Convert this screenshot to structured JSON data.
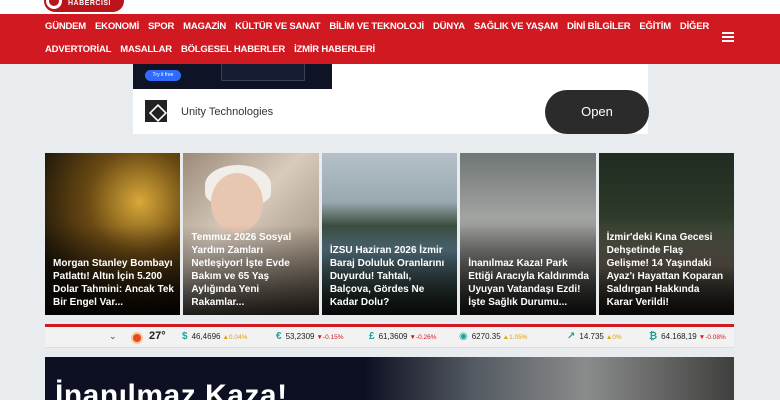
{
  "logo": {
    "text": "HABERCİSİ"
  },
  "nav": {
    "row1": [
      "GÜNDEM",
      "EKONOMİ",
      "SPOR",
      "MAGAZİN",
      "KÜLTÜR VE SANAT",
      "BİLİM VE TEKNOLOJİ",
      "DÜNYA",
      "SAĞLIK VE YAŞAM",
      "DİNİ BİLGİLER",
      "EĞİTİM",
      "DİĞER"
    ],
    "row2": [
      "ADVERTORİAL",
      "MASALLAR",
      "BÖLGESEL HABERLER",
      "İZMİR HABERLERİ"
    ]
  },
  "ad": {
    "try_label": "Try it free",
    "advertiser": "Unity Technologies",
    "cta": "Open"
  },
  "cards": [
    {
      "title": "Morgan Stanley Bombayı Patlattı! Altın İçin 5.200 Dolar Tahmini: Ancak Tek Bir Engel Var..."
    },
    {
      "title": "Temmuz 2026 Sosyal Yardım Zamları Netleşiyor! İşte Evde Bakım ve 65 Yaş Aylığında Yeni Rakamlar..."
    },
    {
      "title": "İZSU Haziran 2026 İzmir Baraj Doluluk Oranlarını Duyurdu! Tahtalı, Balçova, Gördes Ne Kadar Dolu?"
    },
    {
      "title": "İnanılmaz Kaza! Park Ettiği Aracıyla Kaldırımda Uyuyan Vatandaşı Ezdi! İşte Sağlık Durumu..."
    },
    {
      "title": "İzmir'deki Kına Gecesi Dehşetinde Flaş Gelişme! 14 Yaşındaki Ayaz'ı Hayattan Koparan Saldırgan Hakkında Karar Verildi!"
    }
  ],
  "ticker": {
    "chevron": "⌄",
    "temperature": "27°",
    "items": [
      {
        "symbol": "$",
        "value": "46,4696",
        "change": "0.04%",
        "dir": "up",
        "arrow": "▲"
      },
      {
        "symbol": "€",
        "value": "53,2309",
        "change": "-0.15%",
        "dir": "down",
        "arrow": "▼"
      },
      {
        "symbol": "£",
        "value": "61,3609",
        "change": "-0.26%",
        "dir": "down",
        "arrow": "▼"
      },
      {
        "symbol": "◉",
        "value": "6270.35",
        "change": "1.05%",
        "dir": "up",
        "arrow": "▲"
      },
      {
        "symbol": "↗",
        "value": "14.735",
        "change": "0%",
        "dir": "up",
        "arrow": "▲"
      },
      {
        "symbol": "₿",
        "value": "64.168,19",
        "change": "-0.08%",
        "dir": "down",
        "arrow": "▼"
      }
    ]
  },
  "hero": {
    "title": "İnanılmaz Kaza!"
  }
}
